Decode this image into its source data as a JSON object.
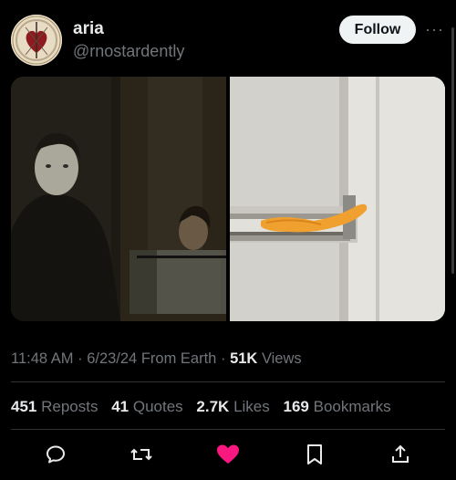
{
  "post": {
    "author_name": "aria",
    "author_handle": "@rnostardently",
    "follow_label": "Follow",
    "more_label": "···",
    "time": "11:48 AM",
    "date": "6/23/24",
    "source": "From Earth",
    "views_count": "51K",
    "views_label": "Views",
    "separator": "·"
  },
  "stats": [
    {
      "count": "451",
      "label": "Reposts"
    },
    {
      "count": "41",
      "label": "Quotes"
    },
    {
      "count": "2.7K",
      "label": "Likes"
    },
    {
      "count": "169",
      "label": "Bookmarks"
    }
  ],
  "actions": [
    "reply-icon",
    "repost-icon",
    "like-icon",
    "bookmark-icon",
    "share-icon"
  ],
  "colors": {
    "background": "#000000",
    "primary_text": "#e7e9ea",
    "secondary_text": "#71767b",
    "like_active": "#f91880",
    "follow_button_bg": "#eff3f4"
  }
}
